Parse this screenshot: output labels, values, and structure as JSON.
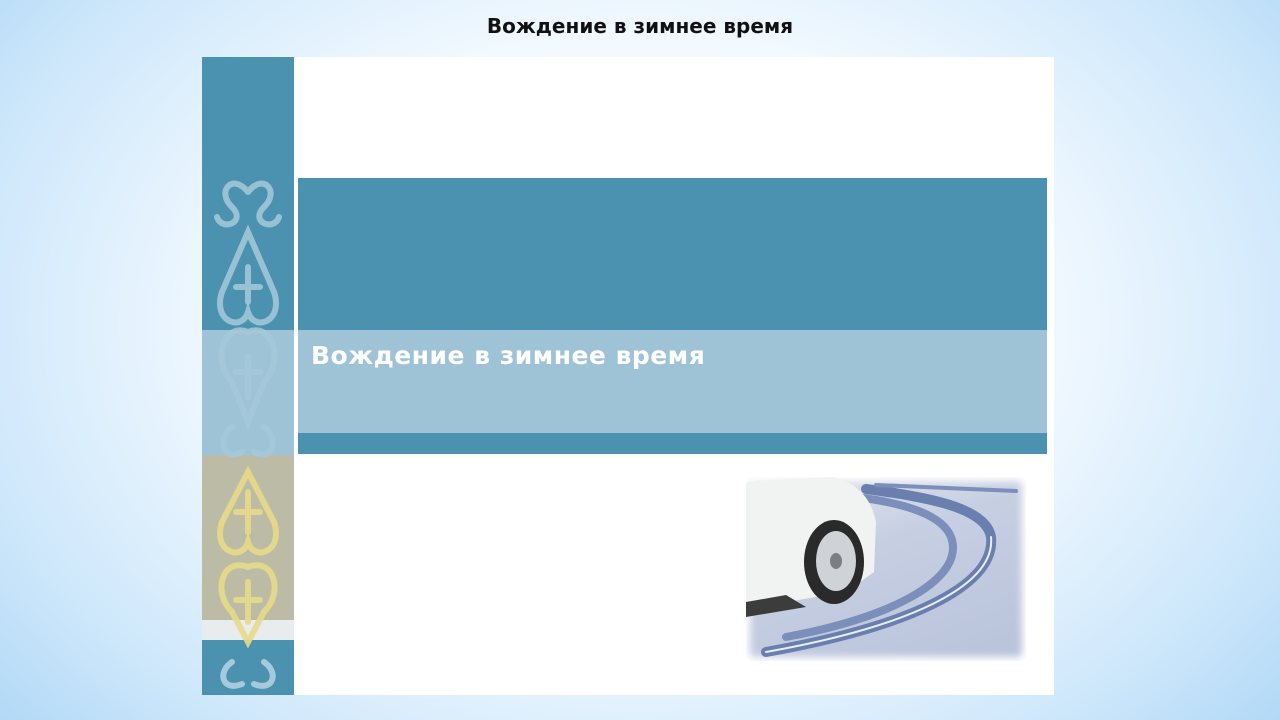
{
  "header": {
    "title": "Вождение в зимнее время"
  },
  "slide": {
    "title": "Вождение в зимнее время",
    "image": "car-on-snowy-road",
    "colors": {
      "teal": "#4b92b0",
      "light_teal": "#9fc3d6",
      "ornament_yellow": "#e8da8a"
    }
  }
}
